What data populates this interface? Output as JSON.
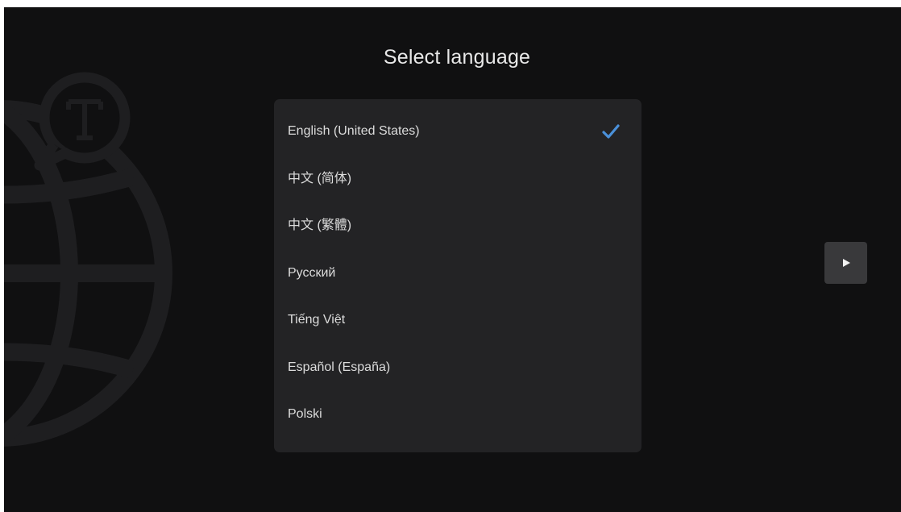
{
  "screen": {
    "title": "Select language"
  },
  "languages": [
    {
      "label": "English (United States)",
      "selected": true
    },
    {
      "label": "中文 (简体)",
      "selected": false
    },
    {
      "label": "中文 (繁體)",
      "selected": false
    },
    {
      "label": "Русский",
      "selected": false
    },
    {
      "label": "Tiếng Việt",
      "selected": false
    },
    {
      "label": "Español (España)",
      "selected": false
    },
    {
      "label": "Polski",
      "selected": false
    }
  ],
  "icons": {
    "background": "globe-translate-icon",
    "selected_marker": "checkmark-icon",
    "next": "play-arrow-icon"
  },
  "colors": {
    "background": "#101011",
    "panel": "#232325",
    "accent": "#4a90d9",
    "text": "#dcdcdc"
  }
}
